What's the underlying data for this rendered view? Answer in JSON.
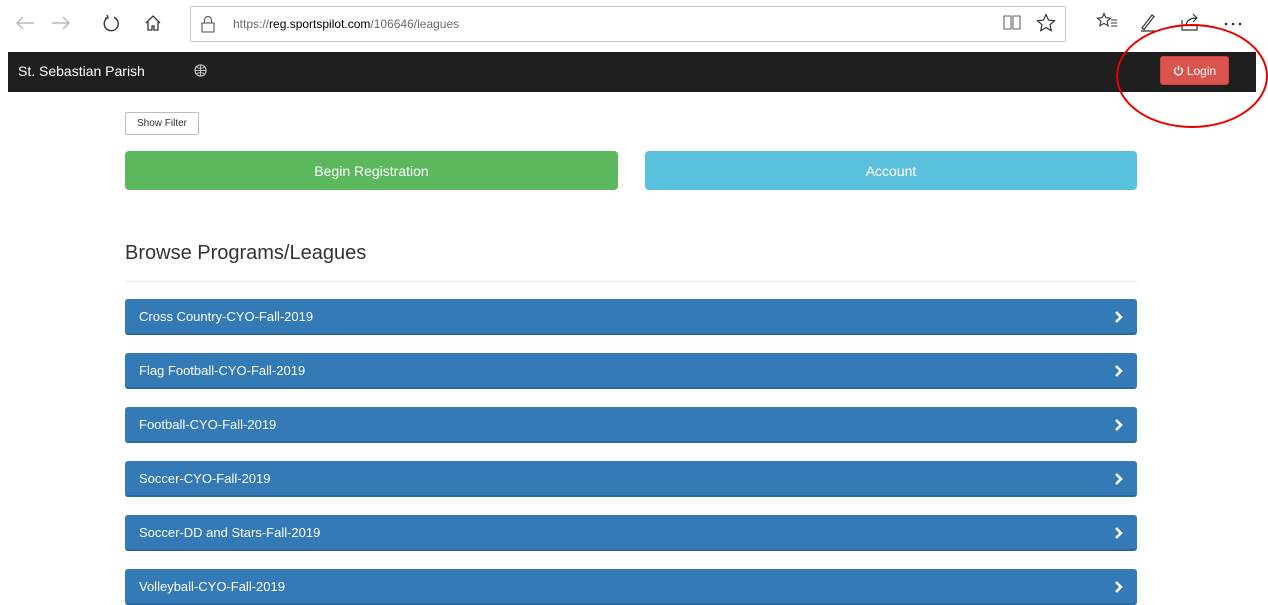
{
  "browser": {
    "url_prefix": "https://",
    "url_domain": "reg.sportspilot.com",
    "url_path": "/106646/leagues"
  },
  "app": {
    "brand": "St. Sebastian Parish",
    "login_label": "Login"
  },
  "main": {
    "show_filter_label": "Show Filter",
    "begin_registration_label": "Begin Registration",
    "account_label": "Account",
    "section_title": "Browse Programs/Leagues",
    "leagues": [
      {
        "label": "Cross Country-CYO-Fall-2019"
      },
      {
        "label": "Flag Football-CYO-Fall-2019"
      },
      {
        "label": "Football-CYO-Fall-2019"
      },
      {
        "label": "Soccer-CYO-Fall-2019"
      },
      {
        "label": "Soccer-DD and Stars-Fall-2019"
      },
      {
        "label": "Volleyball-CYO-Fall-2019"
      }
    ]
  },
  "colors": {
    "nav_bg": "#1f1f1f",
    "login_red": "#d9534f",
    "success_green": "#5cb85c",
    "info_blue": "#5bc0de",
    "primary_blue": "#337ab7"
  },
  "icons": [
    "back-icon",
    "forward-icon",
    "refresh-icon",
    "home-icon",
    "lock-icon",
    "reading-view-icon",
    "favorite-star-icon",
    "favorites-list-icon",
    "pen-icon",
    "share-icon",
    "more-icon",
    "globe-icon",
    "power-icon",
    "chevron-right-icon"
  ]
}
